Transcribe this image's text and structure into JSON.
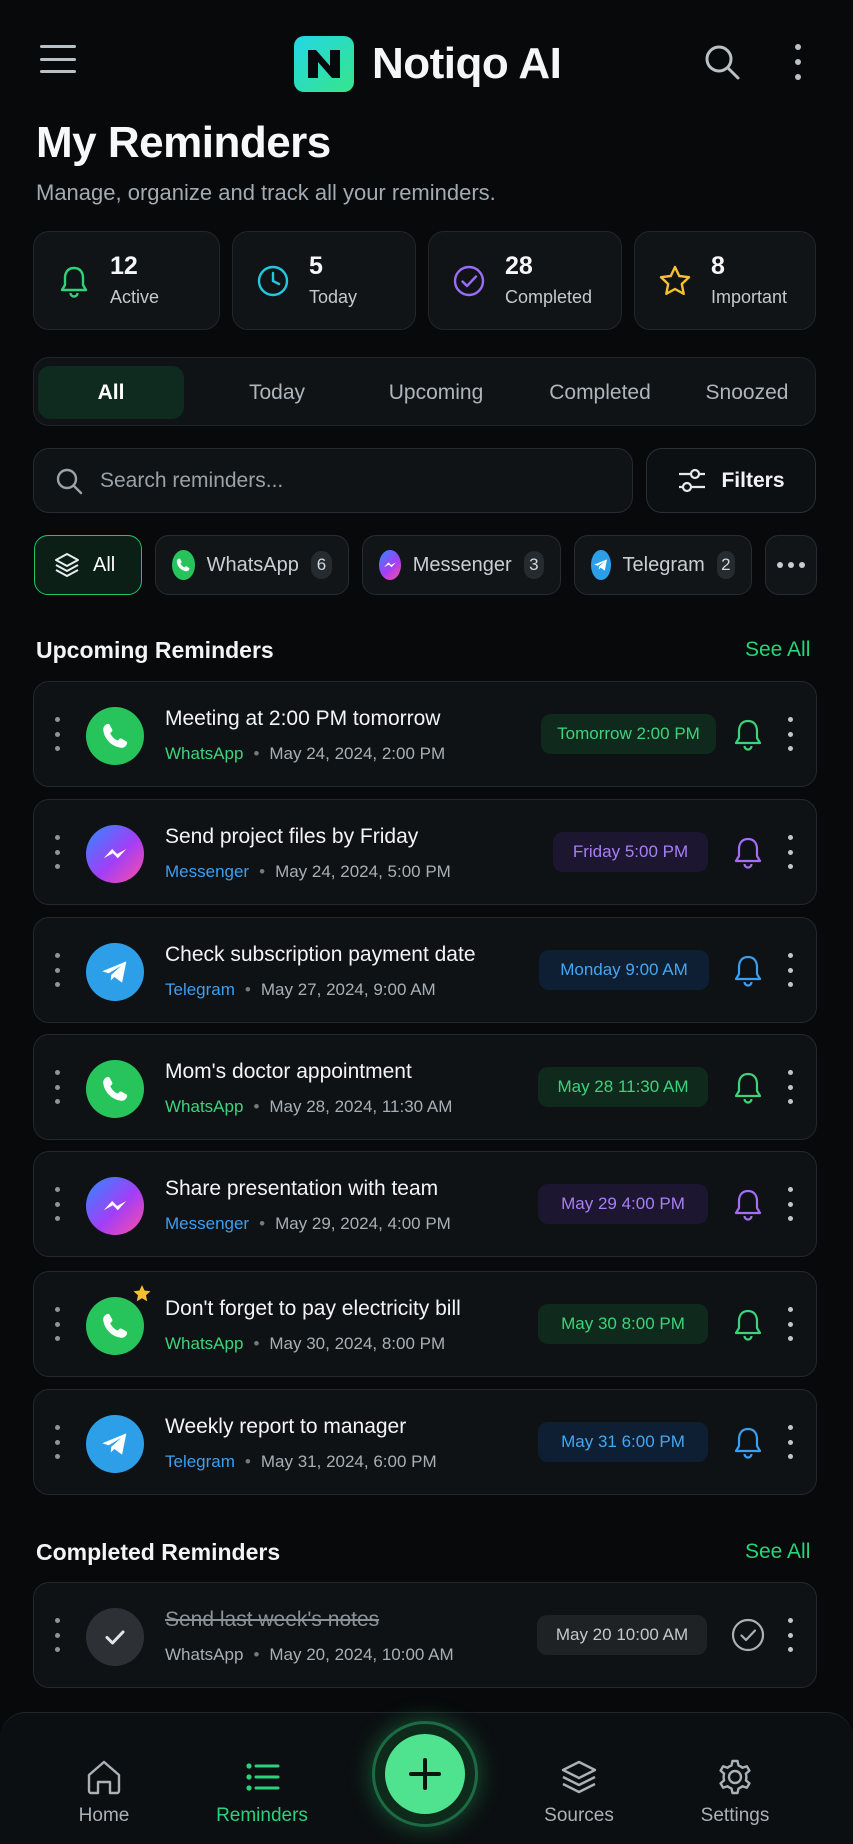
{
  "app": {
    "name": "Notiqo AI"
  },
  "page": {
    "title": "My Reminders",
    "subtitle": "Manage, organize and track all your reminders."
  },
  "stats": [
    {
      "value": "12",
      "label": "Active",
      "icon": "bell-icon",
      "color": "#2fd37c"
    },
    {
      "value": "5",
      "label": "Today",
      "icon": "clock-icon",
      "color": "#23c7e0"
    },
    {
      "value": "28",
      "label": "Completed",
      "icon": "check-circle-icon",
      "color": "#9b6cf5"
    },
    {
      "value": "8",
      "label": "Important",
      "icon": "star-icon",
      "color": "#f5c02b"
    }
  ],
  "tabs": [
    {
      "label": "All",
      "active": true
    },
    {
      "label": "Today"
    },
    {
      "label": "Upcoming"
    },
    {
      "label": "Completed"
    },
    {
      "label": "Snoozed"
    }
  ],
  "search": {
    "placeholder": "Search reminders...",
    "value": ""
  },
  "filters_label": "Filters",
  "sources": [
    {
      "label": "All",
      "active": true,
      "icon": "layers-icon"
    },
    {
      "label": "WhatsApp",
      "count": "6",
      "icon": "whatsapp-icon"
    },
    {
      "label": "Messenger",
      "count": "3",
      "icon": "messenger-icon"
    },
    {
      "label": "Telegram",
      "count": "2",
      "icon": "telegram-icon"
    }
  ],
  "upcoming": {
    "title": "Upcoming Reminders",
    "see_all": "See All",
    "items": [
      {
        "title": "Meeting at 2:00 PM tomorrow",
        "source": "WhatsApp",
        "datetime": "May 24, 2024, 2:00 PM",
        "badge": "Tomorrow 2:00 PM",
        "theme": "green"
      },
      {
        "title": "Send project files by Friday",
        "source": "Messenger",
        "datetime": "May 24, 2024, 5:00 PM",
        "badge": "Friday 5:00 PM",
        "theme": "purple"
      },
      {
        "title": "Check subscription payment date",
        "source": "Telegram",
        "datetime": "May 27, 2024, 9:00 AM",
        "badge": "Monday 9:00 AM",
        "theme": "blue"
      },
      {
        "title": "Mom's doctor appointment",
        "source": "WhatsApp",
        "datetime": "May 28, 2024, 11:30 AM",
        "badge": "May 28  11:30 AM",
        "theme": "green"
      },
      {
        "title": "Share presentation with team",
        "source": "Messenger",
        "datetime": "May 29, 2024, 4:00 PM",
        "badge": "May 29  4:00 PM",
        "theme": "purple"
      },
      {
        "title": "Don't forget to pay electricity bill",
        "source": "WhatsApp",
        "datetime": "May 30, 2024, 8:00 PM",
        "badge": "May 30  8:00 PM",
        "theme": "green",
        "starred": true
      },
      {
        "title": "Weekly report to manager",
        "source": "Telegram",
        "datetime": "May 31, 2024, 6:00 PM",
        "badge": "May 31  6:00 PM",
        "theme": "blue"
      }
    ]
  },
  "completed": {
    "title": "Completed Reminders",
    "see_all": "See All",
    "items": [
      {
        "title": "Send last week's notes",
        "source": "WhatsApp",
        "datetime": "May 20, 2024, 10:00 AM",
        "badge": "May 20  10:00 AM",
        "theme": "gray"
      }
    ]
  },
  "nav": [
    {
      "label": "Home",
      "icon": "home-icon"
    },
    {
      "label": "Reminders",
      "icon": "list-icon",
      "active": true
    },
    {
      "label": "Sources",
      "icon": "layers-icon"
    },
    {
      "label": "Settings",
      "icon": "gear-icon"
    }
  ],
  "colors": {
    "accent": "#2ad27b",
    "whatsapp": "#27c45b",
    "telegram": "#2c9fe8",
    "messenger_purple": "#a46ef5"
  }
}
